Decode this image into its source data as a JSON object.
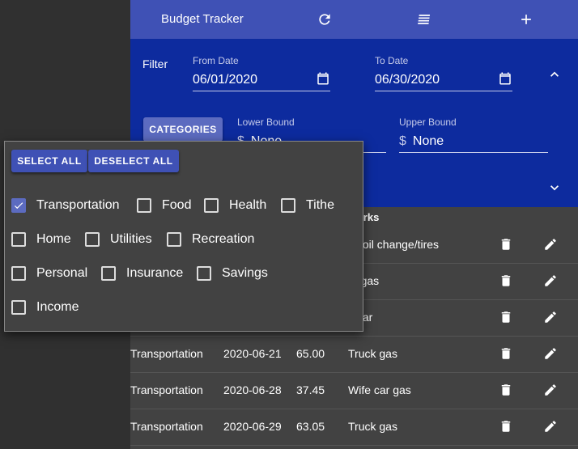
{
  "appbar": {
    "title": "Budget Tracker",
    "refresh_icon": "refresh-icon",
    "sort_icon": "sort-icon",
    "add_icon": "add-icon"
  },
  "filter": {
    "label": "Filter",
    "from_date_label": "From Date",
    "from_date_value": "06/01/2020",
    "to_date_label": "To Date",
    "to_date_value": "06/30/2020",
    "categories_button": "CATEGORIES",
    "lower_bound_label": "Lower Bound",
    "lower_bound_value": "None",
    "upper_bound_label": "Upper Bound",
    "upper_bound_value": "None",
    "currency": "$"
  },
  "table": {
    "remarks_header": "marks",
    "rows": [
      {
        "category": "",
        "date": "",
        "amount": "",
        "remarks": "ck oil change/tires"
      },
      {
        "category": "",
        "date": "",
        "amount": "",
        "remarks": "fe gas"
      },
      {
        "category": "",
        "date": "",
        "amount": "",
        "remarks": "s car"
      },
      {
        "category": "Transportation",
        "date": "2020-06-21",
        "amount": "65.00",
        "remarks": "Truck gas"
      },
      {
        "category": "Transportation",
        "date": "2020-06-28",
        "amount": "37.45",
        "remarks": "Wife car gas"
      },
      {
        "category": "Transportation",
        "date": "2020-06-29",
        "amount": "63.05",
        "remarks": "Truck gas"
      }
    ]
  },
  "popover": {
    "select_all": "SELECT ALL",
    "deselect_all": "DESELECT ALL",
    "categories": [
      {
        "label": "Transportation",
        "checked": true
      },
      {
        "label": "Food",
        "checked": false
      },
      {
        "label": "Health",
        "checked": false
      },
      {
        "label": "Tithe",
        "checked": false
      },
      {
        "label": "Home",
        "checked": false
      },
      {
        "label": "Utilities",
        "checked": false
      },
      {
        "label": "Recreation",
        "checked": false
      },
      {
        "label": "Personal",
        "checked": false
      },
      {
        "label": "Insurance",
        "checked": false
      },
      {
        "label": "Savings",
        "checked": false
      },
      {
        "label": "Income",
        "checked": false
      }
    ]
  },
  "colors": {
    "appbar": "#3f51b5",
    "filter_panel": "#0d2b9e",
    "background": "#303030",
    "surface": "#424242",
    "accent": "#5c6bc0"
  }
}
